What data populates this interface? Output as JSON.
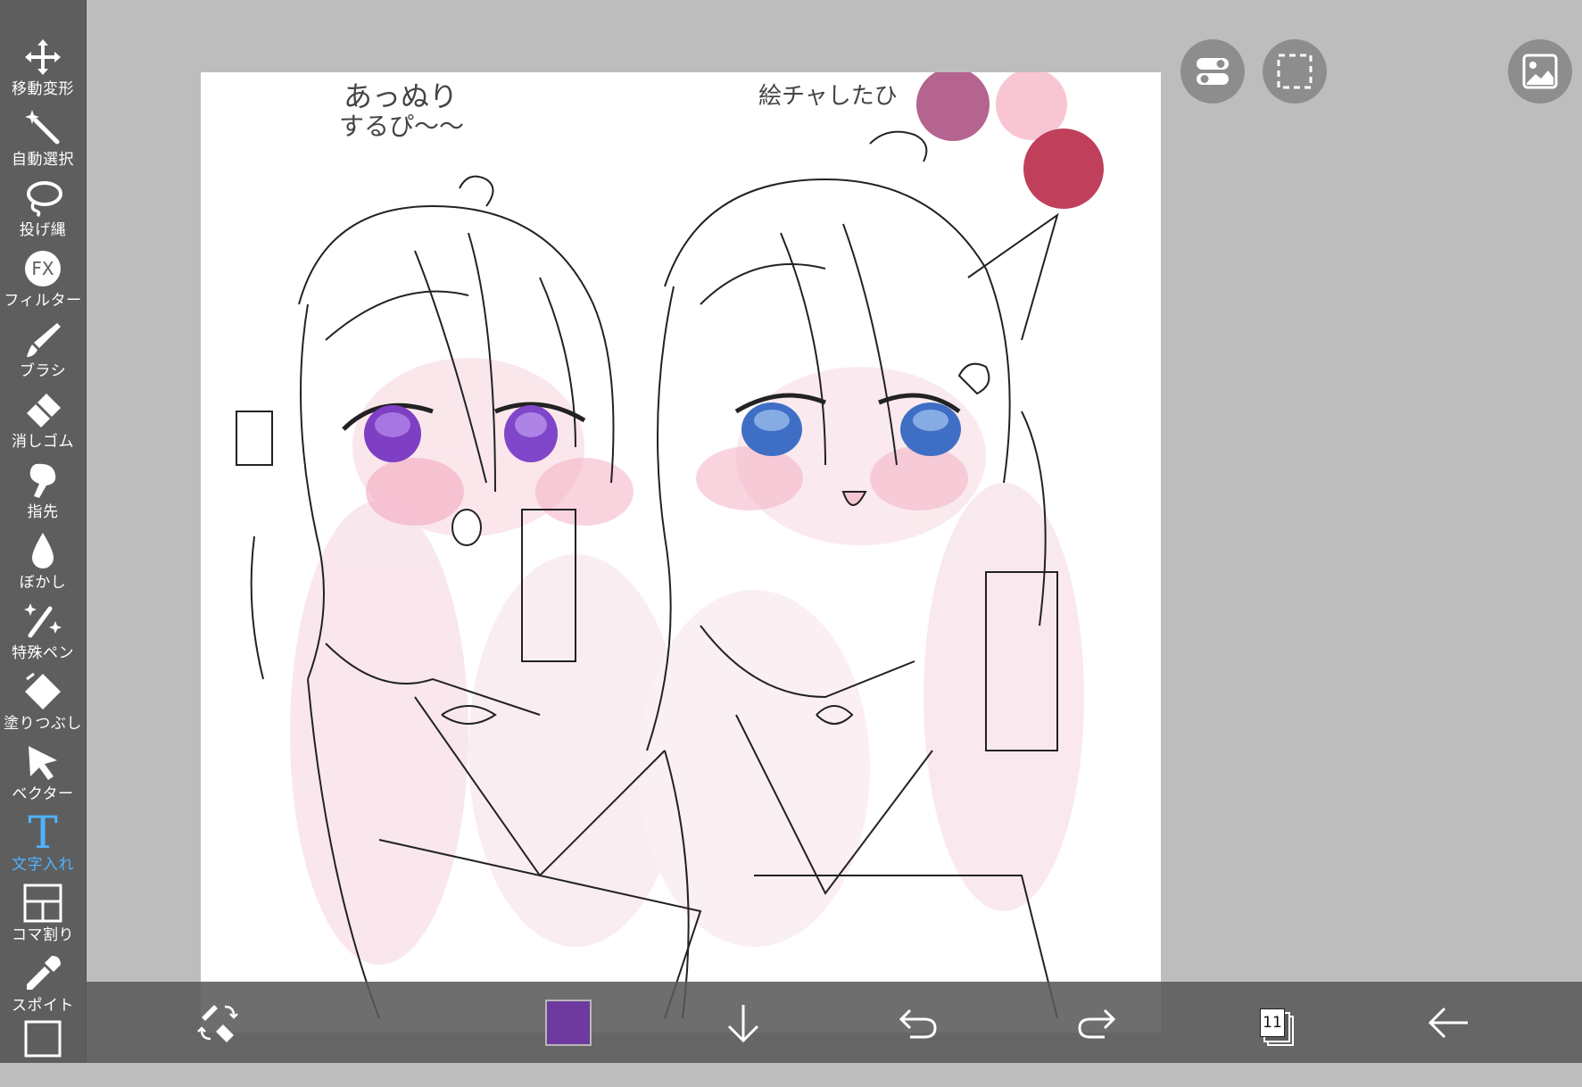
{
  "toolbar": {
    "tools": [
      {
        "label": "移動変形",
        "icon": "move-icon"
      },
      {
        "label": "自動選択",
        "icon": "magic-wand-icon"
      },
      {
        "label": "投げ縄",
        "icon": "lasso-icon"
      },
      {
        "label": "フィルター",
        "icon": "fx-icon",
        "icon_text": "FX"
      },
      {
        "label": "ブラシ",
        "icon": "brush-icon"
      },
      {
        "label": "消しゴム",
        "icon": "eraser-icon"
      },
      {
        "label": "指先",
        "icon": "finger-icon"
      },
      {
        "label": "ぼかし",
        "icon": "blur-drop-icon"
      },
      {
        "label": "特殊ペン",
        "icon": "special-pen-icon"
      },
      {
        "label": "塗りつぶし",
        "icon": "fill-icon"
      },
      {
        "label": "ベクター",
        "icon": "vector-cursor-icon"
      },
      {
        "label": "文字入れ",
        "icon": "text-icon",
        "icon_text": "T",
        "active": true
      },
      {
        "label": "コマ割り",
        "icon": "frame-divider-icon"
      },
      {
        "label": "スポイト",
        "icon": "eyedropper-icon"
      },
      {
        "label": "",
        "icon": "canvas-frame-icon"
      }
    ],
    "active_color": "#4fb3ff"
  },
  "canvas": {
    "note_left_line1": "あっぬり",
    "note_left_line2": "するぴ〜〜",
    "note_right": "絵チャしたひ",
    "palette_colors": [
      "#b5638f",
      "#f8c6d3",
      "#c0405c"
    ]
  },
  "top_buttons": [
    {
      "icon": "toggle-settings-icon"
    },
    {
      "icon": "selection-marquee-icon"
    },
    {
      "icon": "gallery-image-icon"
    }
  ],
  "bottom_bar": {
    "current_color": "#6e3aa0",
    "layer_count": "11",
    "buttons": [
      {
        "icon": "brush-eraser-swap-icon"
      },
      {
        "icon": "download-arrow-icon"
      },
      {
        "icon": "undo-icon"
      },
      {
        "icon": "redo-icon"
      },
      {
        "icon": "layers-icon"
      },
      {
        "icon": "back-arrow-icon"
      }
    ]
  }
}
